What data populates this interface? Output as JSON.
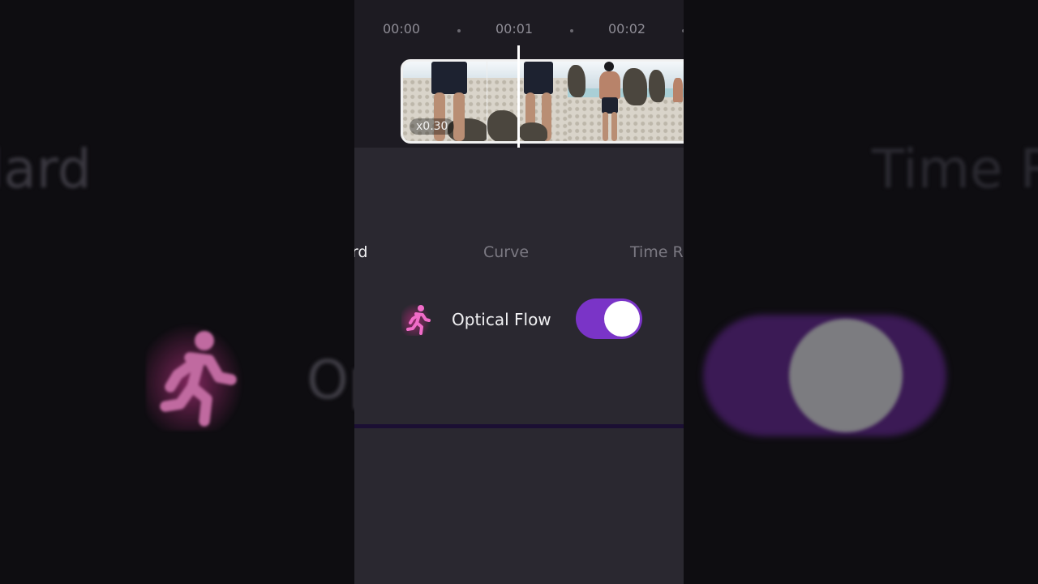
{
  "timeline": {
    "ticks": [
      "00:00",
      "00:01",
      "00:02"
    ],
    "clip": {
      "speed_badge": "x0.30"
    }
  },
  "speed_tabs": {
    "standard": "lard",
    "curve": "Curve",
    "time_remap": "Time R"
  },
  "optical_flow": {
    "label": "Optical Flow",
    "icon": "running-person-icon",
    "enabled": true
  },
  "background_mirror": {
    "left_tab": "lard",
    "left_label": "Op",
    "right_tab": "Time R"
  },
  "colors": {
    "accent": "#7a34c7",
    "icon_pink": "#e06cc0",
    "panel": "#2a2830",
    "timeline_bg": "#1d1b22"
  }
}
